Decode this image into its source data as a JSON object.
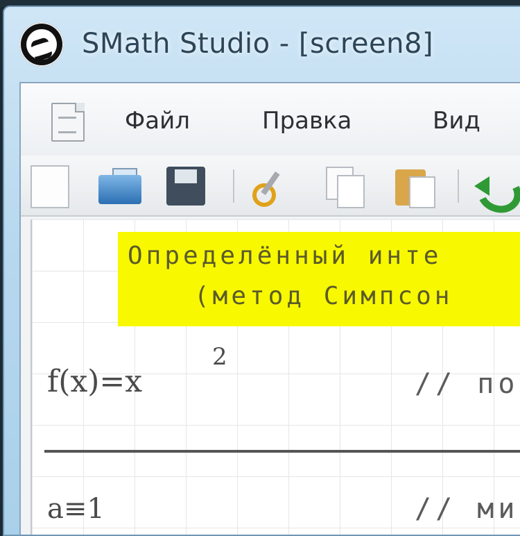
{
  "window": {
    "title": "SMath Studio - [screen8]"
  },
  "menubar": {
    "items": [
      {
        "label": "Файл"
      },
      {
        "label": "Правка"
      },
      {
        "label": "Вид"
      }
    ]
  },
  "toolbar": {
    "buttons": [
      {
        "icon": "new-document-icon"
      },
      {
        "icon": "open-folder-icon"
      },
      {
        "icon": "save-icon"
      },
      {
        "icon": "cut-icon"
      },
      {
        "icon": "copy-icon"
      },
      {
        "icon": "paste-icon"
      },
      {
        "icon": "undo-arrow-icon"
      }
    ]
  },
  "worksheet": {
    "heading": {
      "line1": "Определённый инте",
      "line2": "(метод Симпсон"
    },
    "formula1": {
      "text": "f(x)=x",
      "power": "2",
      "comment": "// по"
    },
    "formula2": {
      "text": "a≡1",
      "comment": "// ми"
    }
  },
  "colors": {
    "heading_highlight": "#f8f800",
    "undo_green": "#2f9a35"
  }
}
